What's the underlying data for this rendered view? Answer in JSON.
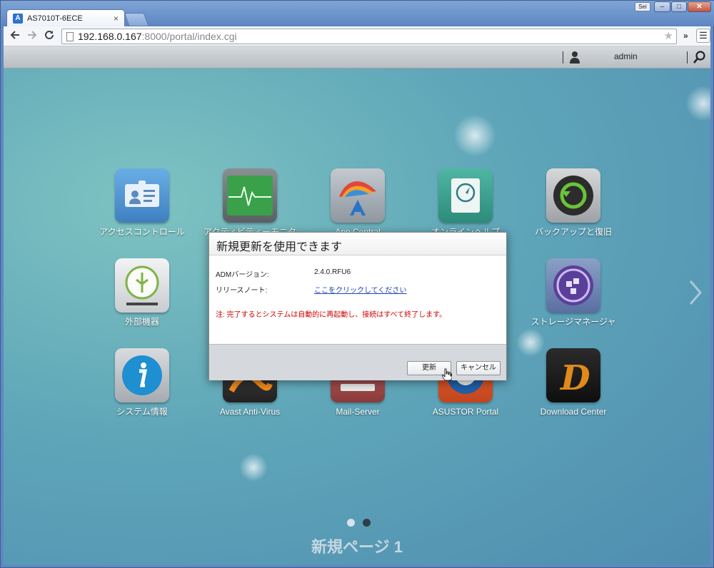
{
  "browser": {
    "tab_title": "AS7010T-6ECE",
    "tab_close": "×",
    "favicon_letter": "A",
    "user_chip": "Sei",
    "window_min": "–",
    "window_max": "□",
    "window_close": "✕",
    "url_host": "192.168.0.167",
    "url_rest": ":8000/portal/index.cgi",
    "overflow_chevron": "»",
    "menu_glyph": "☰"
  },
  "topbar": {
    "username": "admin"
  },
  "apps": [
    {
      "label": "アクセスコントロール",
      "icon": "id-card-icon",
      "color": "#5b9bd5"
    },
    {
      "label": "アクティビティーモニター",
      "icon": "heartbeat-monitor-icon",
      "color": "#4caf50"
    },
    {
      "label": "App Central",
      "icon": "app-central-icon",
      "color": "#9aa3ad"
    },
    {
      "label": "オンラインヘルプ",
      "icon": "compass-book-icon",
      "color": "#3f9f8f"
    },
    {
      "label": "バックアップと復旧",
      "icon": "backup-restore-icon",
      "color": "#555555"
    },
    {
      "label": "外部機器",
      "icon": "usb-icon",
      "color": "#dfe2e4"
    },
    {
      "label": "ストレージマネージャ",
      "icon": "storage-manager-icon",
      "color": "#6d4fa8"
    },
    {
      "label": "システム情報",
      "icon": "info-icon",
      "color": "#1e8fd0"
    },
    {
      "label": "Avast Anti-Virus",
      "icon": "avast-icon",
      "color": "#f08a1c"
    },
    {
      "label": "Mail-Server",
      "icon": "mail-server-icon",
      "color": "#c05050"
    },
    {
      "label": "ASUSTOR Portal",
      "icon": "asustor-portal-icon",
      "color": "#e05a2a"
    },
    {
      "label": "Download Center",
      "icon": "download-center-icon",
      "color": "#e08a1c"
    }
  ],
  "pager": {
    "page_title": "新規ページ 1",
    "active_page": 2,
    "page_count": 2
  },
  "dialog": {
    "title": "新規更新を使用できます",
    "adm_version_label": "ADMバージョン:",
    "adm_version_value": "2.4.0.RFU6",
    "release_notes_label": "リリースノート:",
    "release_notes_link": "ここをクリックしてください",
    "warning": "注: 完了するとシステムは自動的に再起動し、接続はすべて終了します。",
    "update_button": "更新",
    "cancel_button": "キャンセル"
  }
}
